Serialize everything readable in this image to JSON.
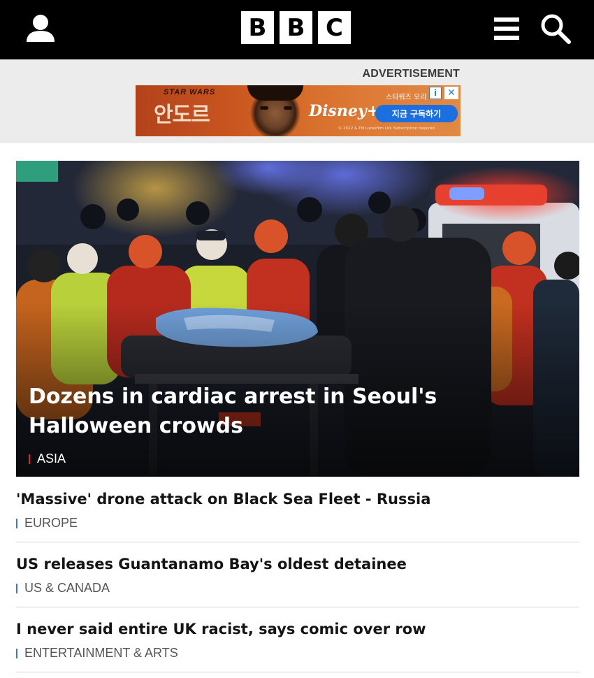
{
  "header": {
    "logo_letters": [
      "B",
      "B",
      "C"
    ],
    "icons": {
      "account": "user-icon",
      "menu": "menu-icon",
      "search": "search-icon"
    },
    "background_color": "#000000"
  },
  "advertisement": {
    "label": "ADVERTISEMENT",
    "brand": "STAR WARS",
    "title": "안도르",
    "service": "Disney+",
    "top_text": "스타워즈 오리",
    "cta": "지금 구독하기",
    "legal": "© 2022 & TM Lucasfilm Ltd. Subscription required.",
    "info_icon": "info-icon",
    "close_icon": "close-icon"
  },
  "hero": {
    "headline": "Dozens in cardiac arrest in Seoul's Halloween crowds",
    "tag": "ASIA",
    "tag_color": "#e2231a"
  },
  "stories": [
    {
      "headline": "'Massive' drone attack on Black Sea Fleet - Russia",
      "tag": "EUROPE"
    },
    {
      "headline": "US releases Guantanamo Bay's oldest detainee",
      "tag": "US & CANADA"
    },
    {
      "headline": "I never said entire UK racist, says comic over row",
      "tag": "ENTERTAINMENT & ARTS"
    }
  ],
  "colors": {
    "tag_bar": "#3b7cb8",
    "divider": "#d6d6d6",
    "ad_background": "#ececec"
  }
}
